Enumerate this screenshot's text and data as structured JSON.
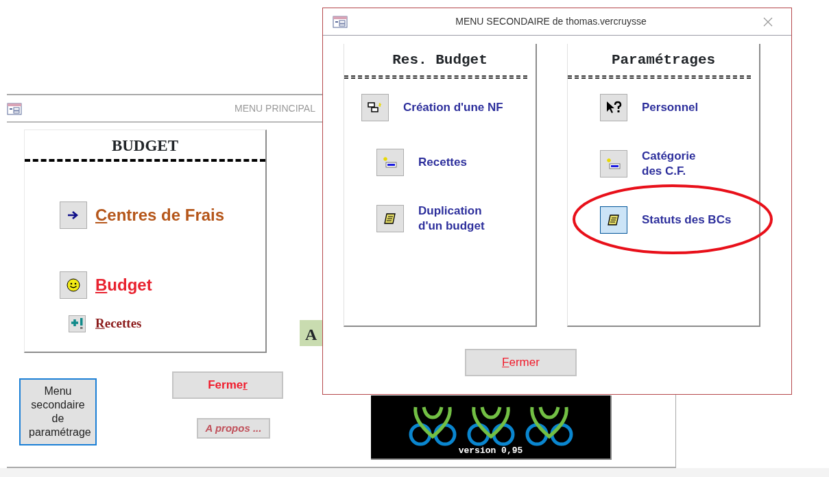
{
  "main_window": {
    "title": "MENU PRINCIPAL",
    "budget_panel": {
      "title": "BUDGET",
      "items": [
        {
          "kind": "large",
          "key": "C",
          "after": "entres de Frais",
          "color": "#b5561a"
        },
        {
          "kind": "large",
          "key": "B",
          "after": "udget",
          "color": "#e8222f"
        },
        {
          "kind": "small",
          "key": "R",
          "after": "ecettes",
          "color": "#8b1a1a"
        }
      ]
    },
    "partial_label": "A",
    "settings_button": "Menu secondaire de paramétrage",
    "close_button": {
      "before": "Ferme",
      "key": "r"
    },
    "about_button": "A propos ...",
    "logo": {
      "caption": "version 0,95"
    }
  },
  "secondary_window": {
    "title": "MENU SECONDAIRE de thomas.vercruysse",
    "panels": [
      {
        "title": "Res. Budget",
        "items": [
          {
            "label": "Création d'une NF",
            "selected": false
          },
          {
            "label": "Recettes",
            "selected": false
          },
          {
            "label": "Duplication\nd'un budget",
            "selected": false
          }
        ]
      },
      {
        "title": "Paramétrages",
        "items": [
          {
            "label": "Personnel",
            "selected": false
          },
          {
            "label": "Catégorie\ndes C.F.",
            "selected": false
          },
          {
            "label": "Statuts des BCs",
            "selected": true
          }
        ]
      }
    ],
    "close_button": {
      "key": "F",
      "after": "ermer"
    }
  }
}
